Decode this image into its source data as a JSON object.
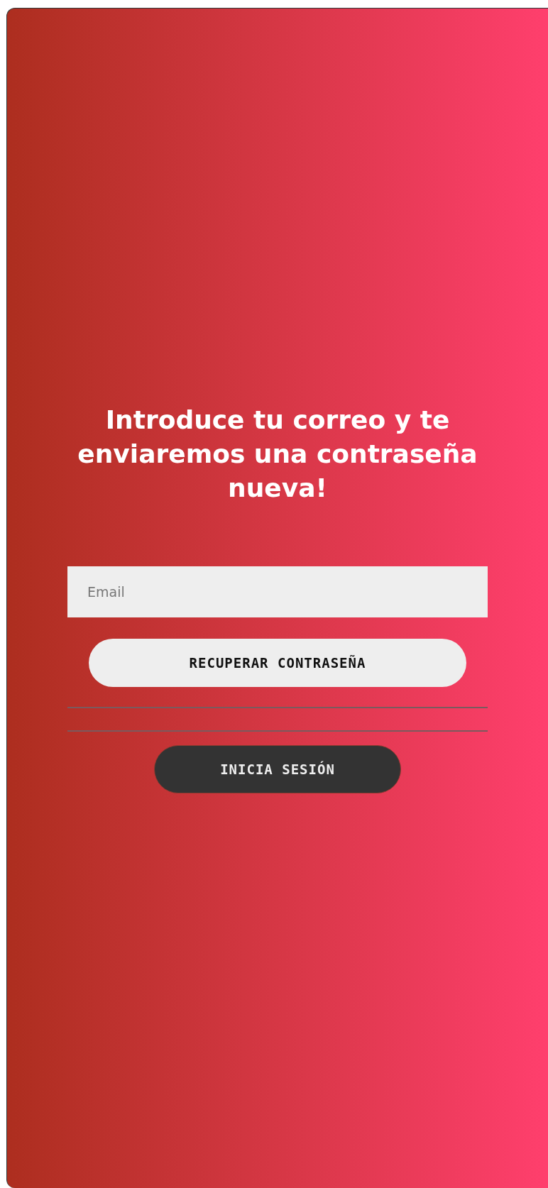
{
  "heading": "Introduce tu correo y te enviaremos una contraseña nueva!",
  "email_field": {
    "placeholder": "Email"
  },
  "recover_button": "RECUPERAR CONTRASEÑA",
  "login_button": "INICIA SESIÓN"
}
